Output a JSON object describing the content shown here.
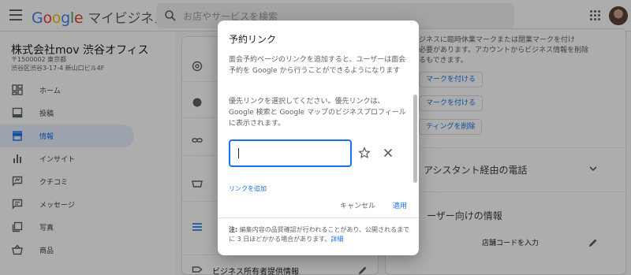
{
  "app": {
    "logo_letters": [
      "G",
      "o",
      "o",
      "g",
      "l",
      "e"
    ],
    "product": "マイビジネス",
    "search_placeholder": "お店やサービスを検索"
  },
  "business": {
    "name": "株式会社mov 渋谷オフィス",
    "address_line1": "〒1500002 東京都",
    "address_line2": "渋谷区渋谷3-17-4 新山口ビル4F"
  },
  "sidebar": {
    "items": [
      {
        "label": "ホーム",
        "icon": "dashboard-icon"
      },
      {
        "label": "投稿",
        "icon": "post-icon"
      },
      {
        "label": "情報",
        "icon": "storefront-icon",
        "active": true
      },
      {
        "label": "インサイト",
        "icon": "bar-chart-icon"
      },
      {
        "label": "クチコミ",
        "icon": "reviews-icon"
      },
      {
        "label": "メッセージ",
        "icon": "message-icon"
      },
      {
        "label": "写真",
        "icon": "photos-icon"
      },
      {
        "label": "商品",
        "icon": "products-icon"
      }
    ]
  },
  "main": {
    "right_text": "ジネスに臨時休業マークまたは閉業マークを付け\n必要があります。アカウントからビジネス情報を削除\nるもできます。",
    "buttons": [
      "マークを付ける",
      "マークを付ける",
      "ティングを削除"
    ],
    "section_phone": "アシスタント経由の電話",
    "section_user": "ーザー向けの情報",
    "store_code_label": "店舗コードを入力",
    "owner_info": "ビジネス所有者提供情報"
  },
  "dialog": {
    "title": "予約リンク",
    "paragraph1": "面会予約ページのリンクを追加すると、ユーザーは面会予約を Google から行うことができるようになります",
    "paragraph2": "優先リンクを選択してください。優先リンクは、Google 検索と Google マップのビジネスプロフィールに表示されます。",
    "input_value": "",
    "add_link_label": "リンクを追加",
    "cancel_label": "キャンセル",
    "apply_label": "適用",
    "note_bold": "注:",
    "note_text": " 編集内容の品質確認が行われることがあり、公開されるまでに 3 日ほどかかる場合があります。",
    "note_link": "詳細"
  },
  "colors": {
    "accent": "#1a73e8",
    "scrim": "rgba(0,0,0,0.32)"
  }
}
